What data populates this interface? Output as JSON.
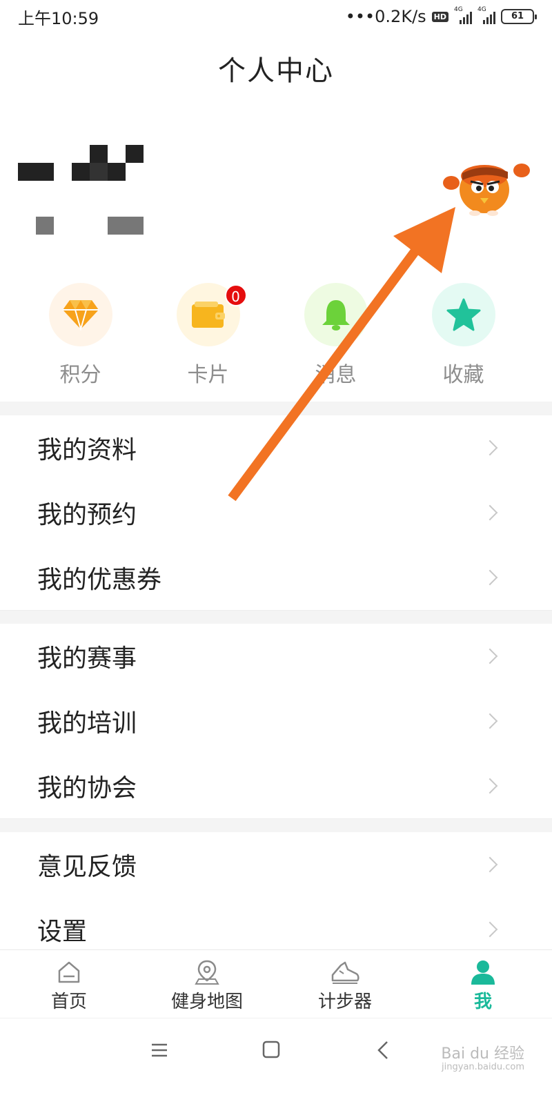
{
  "status_bar": {
    "time": "上午10:59",
    "network_speed": "•••0.2K/s",
    "hd": "HD",
    "sim1": "4G",
    "sim2": "4G",
    "battery": "61"
  },
  "page_title": "个人中心",
  "quick_actions": [
    {
      "label": "积分",
      "icon": "diamond-icon",
      "bg": "#fff4e8",
      "color": "#f7a21b"
    },
    {
      "label": "卡片",
      "icon": "wallet-icon",
      "bg": "#fff6e0",
      "color": "#f7b51e",
      "badge": "0"
    },
    {
      "label": "消息",
      "icon": "bell-icon",
      "bg": "#eefbe2",
      "color": "#6cd23a"
    },
    {
      "label": "收藏",
      "icon": "star-icon",
      "bg": "#e4faf3",
      "color": "#21c29a"
    }
  ],
  "menu_groups": [
    [
      "我的资料",
      "我的预约",
      "我的优惠券"
    ],
    [
      "我的赛事",
      "我的培训",
      "我的协会"
    ],
    [
      "意见反馈",
      "设置"
    ]
  ],
  "tabs": [
    {
      "label": "首页",
      "icon": "home-icon",
      "active": false
    },
    {
      "label": "健身地图",
      "icon": "map-pin-icon",
      "active": false
    },
    {
      "label": "计步器",
      "icon": "sneaker-icon",
      "active": false
    },
    {
      "label": "我",
      "icon": "person-icon",
      "active": true
    }
  ],
  "watermark": {
    "brand": "Bai du 经验",
    "url": "jingyan.baidu.com"
  },
  "colors": {
    "accent": "#1ab99a",
    "arrow": "#f27323",
    "badge": "#e50e0e"
  }
}
